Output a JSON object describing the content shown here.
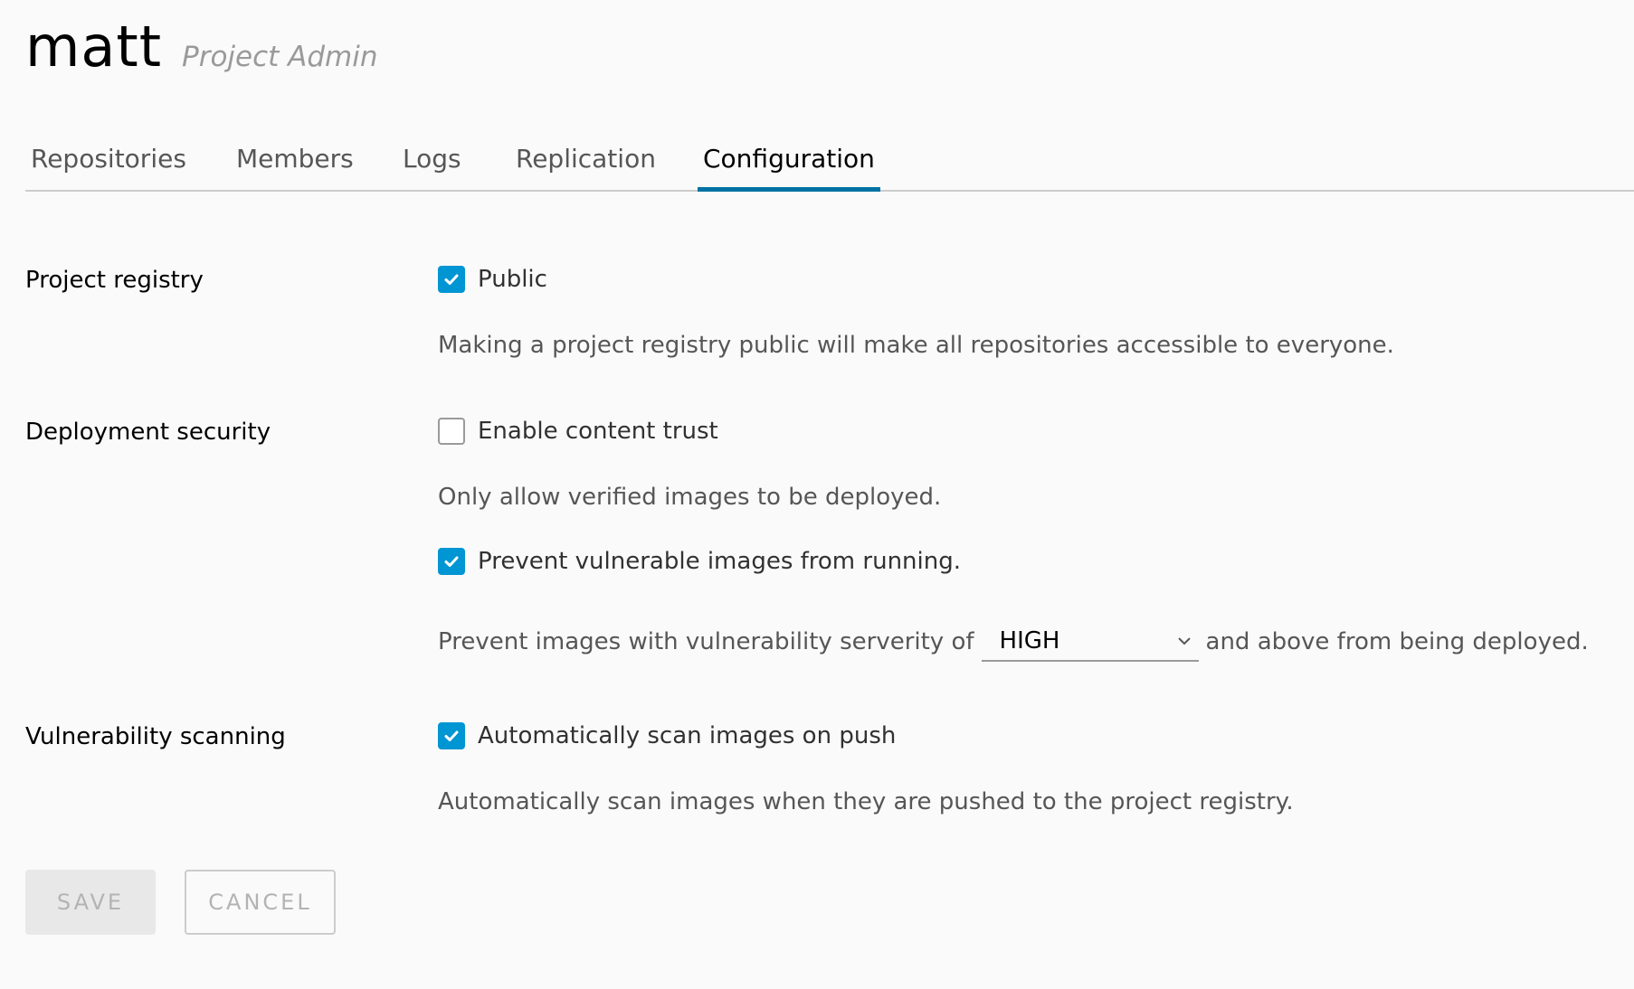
{
  "project": {
    "name": "matt",
    "role": "Project Admin"
  },
  "tabs": [
    {
      "label": "Repositories",
      "active": false
    },
    {
      "label": "Members",
      "active": false
    },
    {
      "label": "Logs",
      "active": false
    },
    {
      "label": "Replication",
      "active": false
    },
    {
      "label": "Configuration",
      "active": true
    }
  ],
  "sections": {
    "registry": {
      "label": "Project registry",
      "public_label": "Public",
      "public_checked": true,
      "description": "Making a project registry public will make all repositories accessible to everyone."
    },
    "deployment": {
      "label": "Deployment security",
      "content_trust_label": "Enable content trust",
      "content_trust_checked": false,
      "content_trust_description": "Only allow verified images to be deployed.",
      "prevent_label": "Prevent vulnerable images from running.",
      "prevent_checked": true,
      "severity_prefix": "Prevent images with vulnerability serverity of",
      "severity_value": "HIGH",
      "severity_suffix": "and above from being deployed."
    },
    "scanning": {
      "label": "Vulnerability scanning",
      "auto_scan_label": "Automatically scan images on push",
      "auto_scan_checked": true,
      "description": "Automatically scan images when they are pushed to the project registry."
    }
  },
  "buttons": {
    "save": "SAVE",
    "cancel": "CANCEL"
  },
  "icons": {
    "checkbox": "check-icon",
    "dropdown": "chevron-down-icon"
  },
  "colors": {
    "accent": "#0072a3",
    "checkbox": "#0095d3"
  }
}
